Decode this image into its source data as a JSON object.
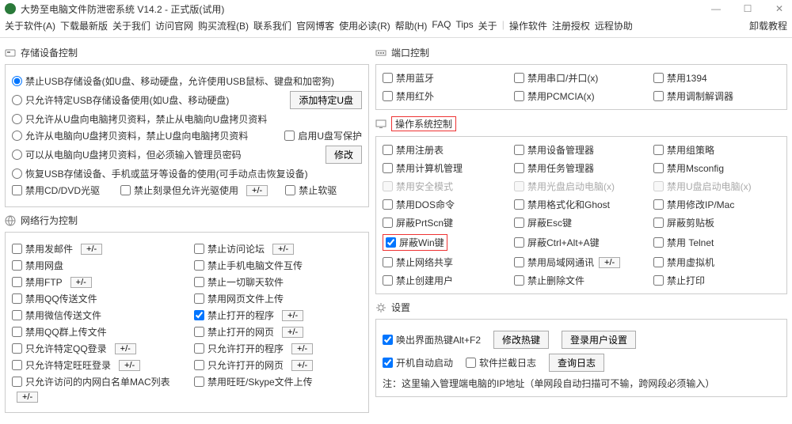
{
  "title": "大势至电脑文件防泄密系统 V14.2 - 正式版(试用)",
  "menu": [
    "关于软件(A)",
    "下载最新版",
    "关于我们",
    "访问官网",
    "购买流程(B)",
    "联系我们",
    "官网博客",
    "使用必读(R)",
    "帮助(H)",
    "FAQ",
    "Tips",
    "关于",
    "操作软件",
    "注册授权",
    "远程协助"
  ],
  "menu_right": "卸载教程",
  "sec_storage_title": "存储设备控制",
  "storage": {
    "r1": "禁止USB存储设备(如U盘、移动硬盘，允许使用USB鼠标、键盘和加密狗)",
    "r2": "只允许特定USB存储设备使用(如U盘、移动硬盘)",
    "btn_add": "添加特定U盘",
    "r3": "只允许从U盘向电脑拷贝资料，禁止从电脑向U盘拷贝资料",
    "r4": "允许从电脑向U盘拷贝资料，禁止U盘向电脑拷贝资料",
    "cb_write": "启用U盘写保护",
    "r5": "可以从电脑向U盘拷贝资料，但必须输入管理员密码",
    "btn_mod": "修改",
    "r6": "恢复USB存储设备、手机或蓝牙等设备的使用(可手动点击恢复设备)",
    "cb_cd": "禁用CD/DVD光驱",
    "cb_burn": "禁止刻录但允许光驱使用",
    "cb_floppy": "禁止软驱",
    "pm": "+/-"
  },
  "sec_net_title": "网络行为控制",
  "net": {
    "c1": [
      "禁用发邮件",
      "禁用网盘",
      "禁用FTP",
      "禁用QQ传送文件",
      "禁用微信传送文件",
      "禁用QQ群上传文件",
      "只允许特定QQ登录",
      "只允许特定旺旺登录",
      "只允许访问的内网白名单MAC列表"
    ],
    "c2": [
      "禁止访问论坛",
      "禁止手机电脑文件互传",
      "禁止一切聊天软件",
      "禁用网页文件上传",
      "禁止打开的程序",
      "禁止打开的网页",
      "只允许打开的程序",
      "只允许打开的网页",
      "禁用旺旺/Skype文件上传"
    ],
    "pm": "+/-"
  },
  "sec_port_title": "端口控制",
  "port": {
    "items": [
      "禁用蓝牙",
      "禁用串口/并口(x)",
      "禁用1394",
      "禁用红外",
      "禁用PCMCIA(x)",
      "禁用调制解调器"
    ]
  },
  "sec_os_title": "操作系统控制",
  "os": {
    "g": [
      "禁用注册表",
      "禁用设备管理器",
      "禁用组策略",
      "禁用计算机管理",
      "禁用任务管理器",
      "禁用Msconfig",
      "禁用安全模式",
      "禁用光盘启动电脑(x)",
      "禁用U盘启动电脑(x)",
      "禁用DOS命令",
      "禁用格式化和Ghost",
      "禁用修改IP/Mac",
      "屏蔽PrtScn键",
      "屏蔽Esc键",
      "屏蔽剪贴板",
      "屏蔽Win键",
      "屏蔽Ctrl+Alt+A键",
      "禁用 Telnet",
      "禁止网络共享",
      "禁用局域网通讯",
      "禁用虚拟机",
      "禁止创建用户",
      "禁止删除文件",
      "禁止打印"
    ],
    "pm": "+/-"
  },
  "sec_set_title": "设置",
  "set": {
    "cb1": "唤出界面热键Alt+F2",
    "btn1": "修改热键",
    "btn2": "登录用户设置",
    "cb2": "开机自动启动",
    "cb3": "软件拦截日志",
    "btn3": "查询日志",
    "note": "注：这里输入管理端电脑的IP地址（单网段自动扫描可不输，跨网段必须输入）"
  }
}
